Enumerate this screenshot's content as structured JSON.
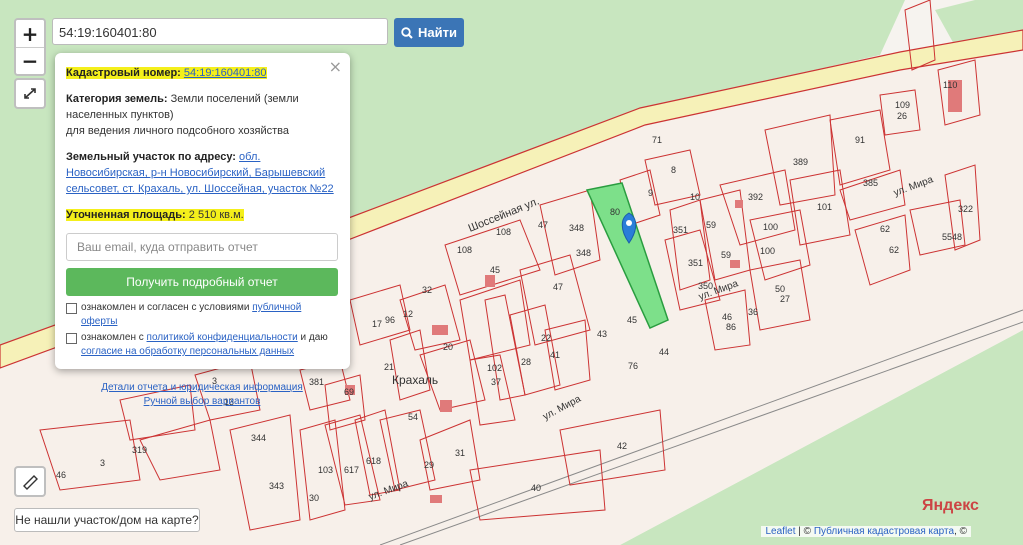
{
  "search": {
    "value": "54:19:160401:80",
    "button_label": "Найти"
  },
  "zoom": {
    "in": "+",
    "out": "−"
  },
  "popup": {
    "cad_label": "Кадастровый номер:",
    "cad_value": "54:19:160401:80",
    "category_label": "Категория земель:",
    "category_value": "Земли поселений (земли населенных пунктов)",
    "category_use": "для ведения личного подсобного хозяйства",
    "address_label": "Земельный участок по адресу:",
    "address_value": "обл. Новосибирская, р-н Новосибирский, Барышевский сельсовет, ст. Крахаль, ул. Шоссейная, участок №22",
    "area_label": "Уточненная площадь:",
    "area_value": "2 510 кв.м.",
    "email_placeholder": "Ваш email, куда отправить отчет",
    "report_button": "Получить подробный отчет",
    "check1_prefix": "ознакомлен и согласен с условиями ",
    "check1_link": "публичной оферты",
    "check2_prefix": "ознакомлен с ",
    "check2_link": "политикой конфиденциальности",
    "check2_mid": " и даю ",
    "check2_link2": "согласие на обработку персональных данных",
    "details_link": "Детали отчета и юридическая информация",
    "manual_link": "Ручной выбор вариантов"
  },
  "not_found_button": "Не нашли участок/дом на карте?",
  "attribution": {
    "leaflet": "Leaflet",
    "sep": " | © ",
    "source": "Публичная кадастровая карта",
    "tail": ", ©"
  },
  "yandex": "Яндекс",
  "map_labels": {
    "street1": "Шоссейная ул.",
    "street2": "ул. Мира",
    "street3": "ул. Мира",
    "street4": "ул. Мира",
    "street5": "ул. Мира",
    "town": "Крахаль",
    "n": [
      "110",
      "109",
      "26",
      "71",
      "389",
      "91",
      "385",
      "392",
      "101",
      "322",
      "100",
      "62",
      "5548",
      "62",
      "100",
      "59",
      "10",
      "9",
      "8",
      "80",
      "351",
      "351",
      "59",
      "350",
      "50",
      "27",
      "36",
      "86",
      "46",
      "348",
      "348",
      "47",
      "108",
      "108",
      "45",
      "47",
      "22",
      "28",
      "20",
      "96",
      "17",
      "32",
      "12",
      "21",
      "381",
      "69",
      "3",
      "13",
      "102",
      "37",
      "41",
      "43",
      "45",
      "44",
      "76",
      "344",
      "42",
      "40",
      "103",
      "617",
      "618",
      "30",
      "343",
      "29",
      "31",
      "54",
      "319",
      "46",
      "3"
    ]
  }
}
